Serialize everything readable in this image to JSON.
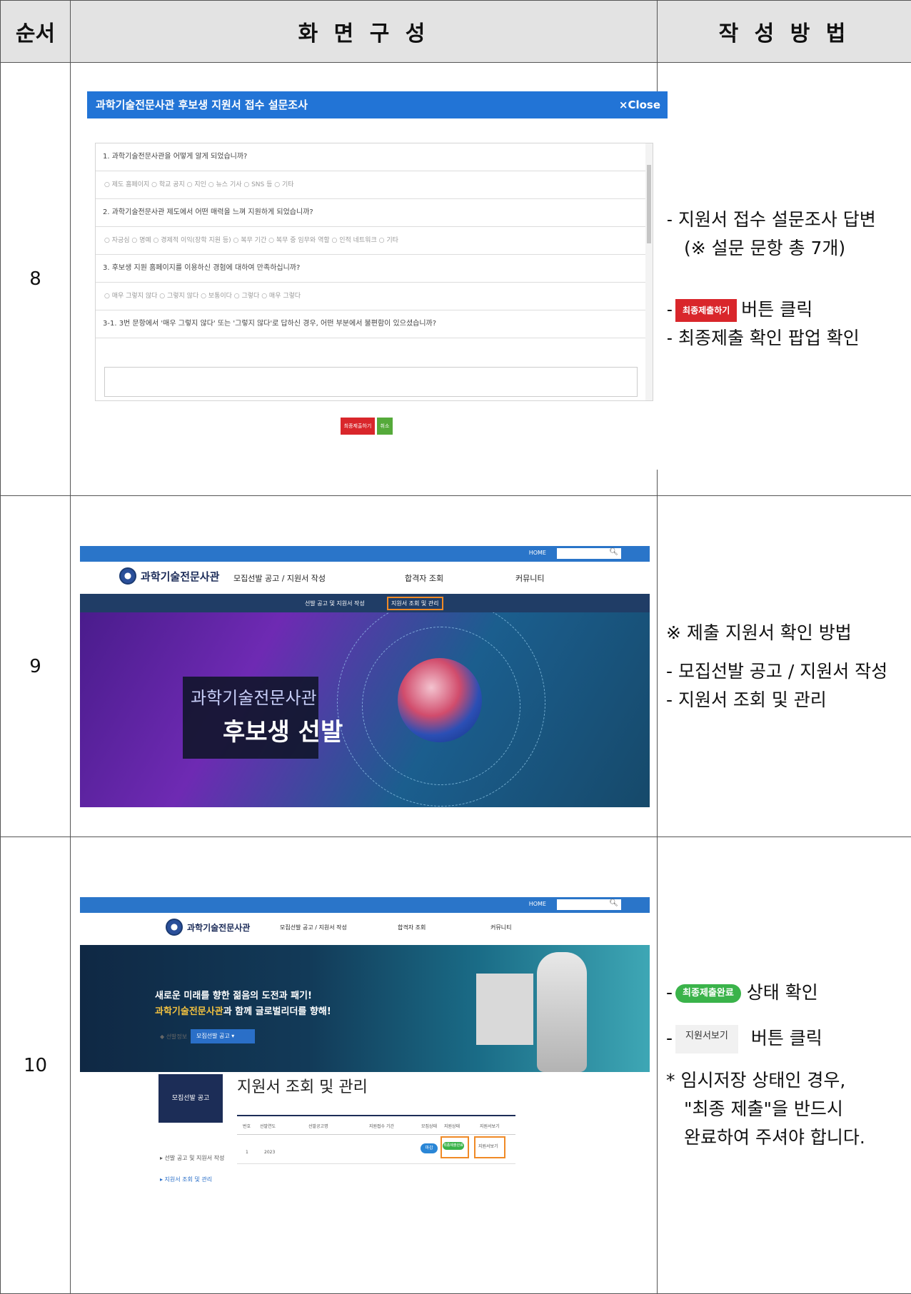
{
  "headers": {
    "order": "순서",
    "screen": "화 면 구 성",
    "method": "작 성 방 법"
  },
  "rows": [
    {
      "num": "8",
      "modal": {
        "title": "과학기술전문사관 후보생 지원서 접수 설문조사",
        "close": "×Close",
        "q1": "1. 과학기술전문사관을 어떻게 알게 되었습니까?",
        "q1_options": "○ 제도 홈페이지 ○ 학교 공지 ○ 지인 ○ 뉴스 기사 ○ SNS 등 ○ 기타",
        "q2": "2. 과학기술전문사관 제도에서 어떤 매력을 느껴 지원하게 되었습니까?",
        "q2_options": "○ 자긍심 ○ 명예 ○ 경제적 이익(장학 지원 등) ○ 복무 기간 ○ 복무 중 임무와 역할 ○ 인적 네트워크 ○ 기타",
        "q3": "3. 후보생 지원 홈페이지를 이용하신 경험에 대하여 만족하십니까?",
        "q3_options": "○ 매우 그렇지 않다 ○ 그렇지 않다 ○ 보통이다 ○ 그렇다 ○ 매우 그렇다",
        "q31": "3-1. 3번 문항에서 '매우 그렇지 않다' 또는 '그렇지 않다'로 답하신 경우, 어떤 부분에서 불편함이 있으셨습니까?",
        "btn_submit": "최종제출하기",
        "btn_cancel": "취소"
      },
      "desc": {
        "line1": "- 지원서 접수 설문조사 답변",
        "line2": "(※ 설문 문항 총 7개)",
        "dash": "-",
        "chip": "최종제출하기",
        "line3_suffix": "버튼 클릭",
        "line4": "- 최종제출 확인 팝업 확인"
      }
    },
    {
      "num": "9",
      "site": {
        "home": "HOME",
        "logo": "과학기술전문사관",
        "nav1": "모집선발 공고 / 지원서 작성",
        "nav2": "합격자 조회",
        "nav3": "커뮤니티",
        "sub1": "선발 공고 및 지원서 작성",
        "sub2": "지원서 조회 및 관리",
        "hero_line1": "과학기술전문사관",
        "hero_line2": "후보생 선발"
      },
      "desc": {
        "line1": "※ 제출 지원서 확인 방법",
        "line2": "- 모집선발 공고 / 지원서 작성",
        "line3": "- 지원서 조회 및 관리"
      }
    },
    {
      "num": "10",
      "site": {
        "home": "HOME",
        "logo": "과학기술전문사관",
        "nav1": "모집선발 공고 / 지원서 작성",
        "nav2": "합격자 조회",
        "nav3": "커뮤니티",
        "hero_line1": "새로운 미래를 향한 젊음의 도전과 패기!",
        "hero_line2_hl": "과학기술전문사관",
        "hero_line2_rest": "과 함께 글로벌리더를 향해!",
        "crumb": "◆ 선발정보",
        "crumb_select": "모집선발 공고",
        "side_box": "모집선발 공고",
        "side1": "▸ 선발 공고 및 지원서 작성",
        "side2": "▸ 지원서 조회 및 관리",
        "page_title": "지원서 조회 및 관리",
        "col_num": "번호",
        "col_year": "선발연도",
        "col_name": "선발공고명",
        "col_period": "지원접수 기간",
        "col_state": "모집상태",
        "col_status": "지원상태",
        "col_view": "지원서보기",
        "row_num": "1",
        "row_year": "2023",
        "row_badge": "마감",
        "row_status": "최종제출완료",
        "row_view": "지원서보기"
      },
      "desc": {
        "dash": "-",
        "chip_green": "최종제출완료",
        "line1_suffix": "상태 확인",
        "chip_gray": "지원서보기",
        "line2_suffix": "버튼 클릭",
        "note1": "* 임시저장 상태인 경우,",
        "note2": "\"최종 제출\"을 반드시",
        "note3": "완료하여 주셔야 합니다."
      }
    }
  ]
}
